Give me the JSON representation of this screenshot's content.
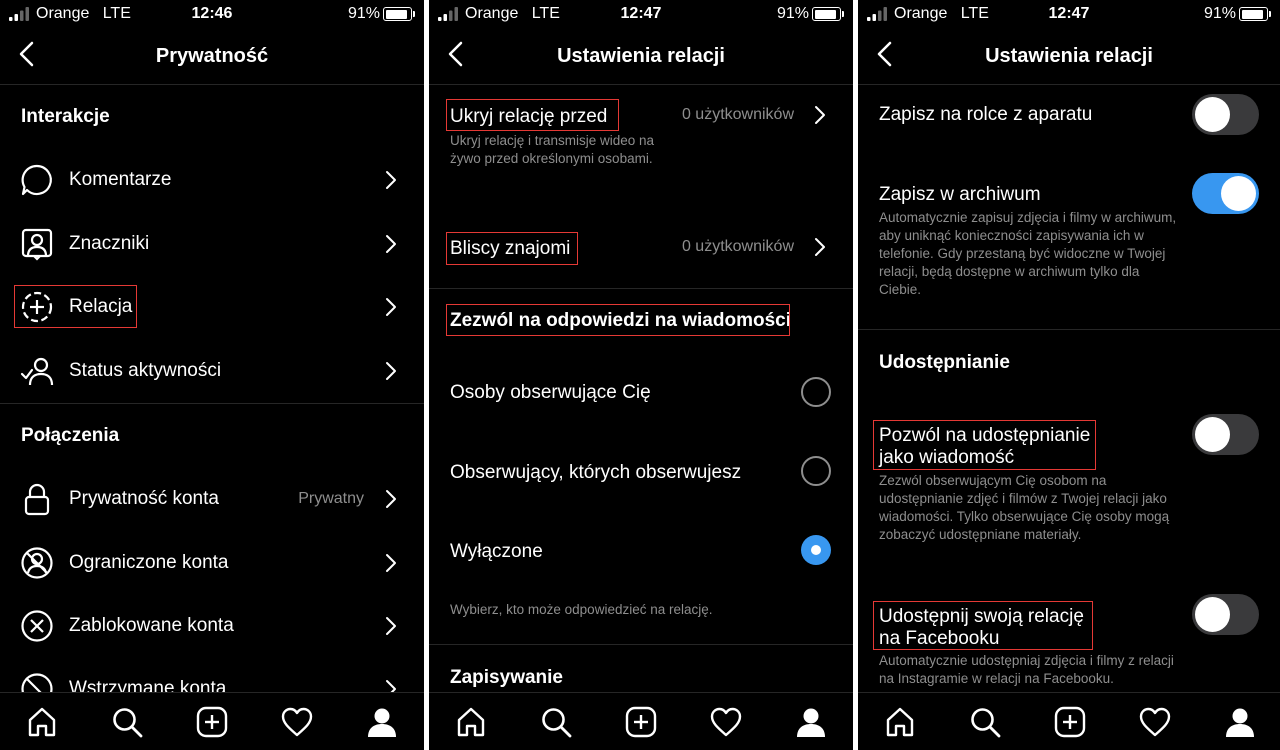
{
  "status": [
    {
      "carrier": "Orange",
      "network": "LTE",
      "time": "12:46",
      "battery": "91%",
      "battery_level": 0.91
    },
    {
      "carrier": "Orange",
      "network": "LTE",
      "time": "12:47",
      "battery": "91%",
      "battery_level": 0.91
    },
    {
      "carrier": "Orange",
      "network": "LTE",
      "time": "12:47",
      "battery": "91%",
      "battery_level": 0.91
    }
  ],
  "panel1": {
    "title": "Prywatność",
    "section_interactions": "Interakcje",
    "section_connections": "Połączenia",
    "items": [
      {
        "label": "Komentarze",
        "icon": "comment-icon"
      },
      {
        "label": "Znaczniki",
        "icon": "tag-icon"
      },
      {
        "label": "Relacja",
        "icon": "story-add-icon"
      },
      {
        "label": "Status aktywności",
        "icon": "activity-status-icon"
      },
      {
        "label": "Prywatność konta",
        "value": "Prywatny",
        "icon": "lock-icon"
      },
      {
        "label": "Ograniczone konta",
        "icon": "restricted-icon"
      },
      {
        "label": "Zablokowane konta",
        "icon": "blocked-icon"
      },
      {
        "label": "Wstrzymane konta",
        "icon": "muted-icon"
      }
    ]
  },
  "panel2": {
    "title": "Ustawienia relacji",
    "hide_story": {
      "label": "Ukryj relację przed",
      "value": "0 użytkowników",
      "desc": "Ukryj relację i transmisje wideo na żywo przed określonymi osobami."
    },
    "close_friends": {
      "label": "Bliscy znajomi",
      "value": "0 użytkowników"
    },
    "replies_heading": "Zezwól na odpowiedzi na wiadomości",
    "reply_options": [
      {
        "label": "Osoby obserwujące Cię",
        "selected": false
      },
      {
        "label": "Obserwujący, których obserwujesz",
        "selected": false
      },
      {
        "label": "Wyłączone",
        "selected": true
      }
    ],
    "replies_hint": "Wybierz, kto może odpowiedzieć na relację.",
    "saving_heading": "Zapisywanie"
  },
  "panel3": {
    "title": "Ustawienia relacji",
    "save_camera_roll": {
      "label": "Zapisz na rolce z aparatu",
      "on": false
    },
    "save_archive": {
      "label": "Zapisz w archiwum",
      "on": true,
      "desc": "Automatycznie zapisuj zdjęcia i filmy w archiwum, aby uniknąć konieczności zapisywania ich w telefonie. Gdy przestaną być widoczne w Twojej relacji, będą dostępne w archiwum tylko dla Ciebie."
    },
    "sharing_heading": "Udostępnianie",
    "allow_sharing": {
      "label_line1": "Pozwól na udostępnianie",
      "label_line2": "jako wiadomość",
      "on": false,
      "desc": "Zezwól obserwującym Cię osobom na udostępnianie zdjęć i filmów z Twojej relacji jako wiadomości. Tylko obserwujące Cię osoby mogą zobaczyć udostępniane materiały."
    },
    "share_facebook": {
      "label_line1": "Udostępnij swoją relację",
      "label_line2": "na Facebooku",
      "on": false,
      "desc": "Automatycznie udostępniaj zdjęcia i filmy z relacji na Instagramie w relacji na Facebooku."
    }
  },
  "tabbar": [
    "home-icon",
    "search-icon",
    "new-post-icon",
    "activity-heart-icon",
    "profile-icon"
  ],
  "colors": {
    "background": "#000000",
    "text": "#ffffff",
    "secondary_text": "#8e8e8e",
    "accent": "#3897f0",
    "highlight": "#e53935",
    "divider": "#262626"
  }
}
